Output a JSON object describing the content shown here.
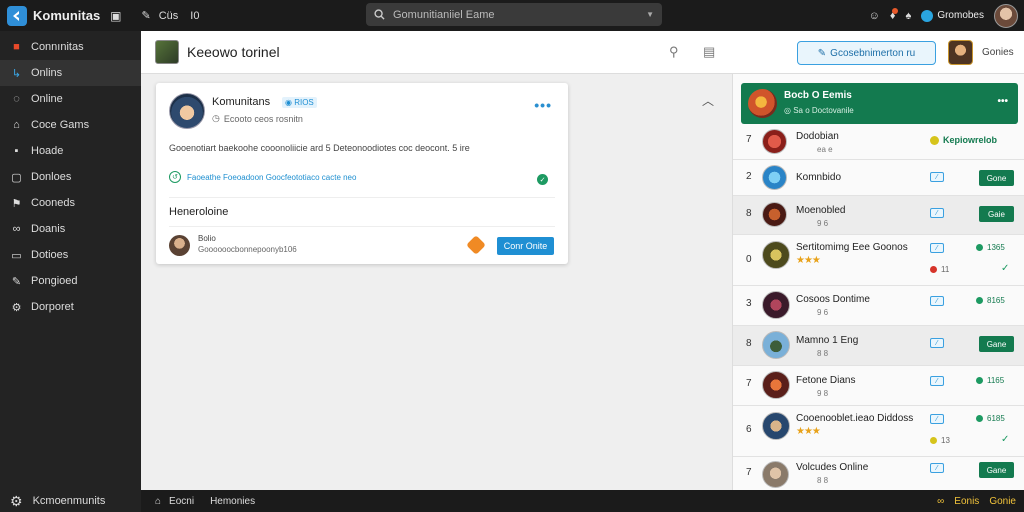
{
  "topbar": {
    "app_title": "Komunitas",
    "icon_a": "▣",
    "link_1": "Cüs",
    "link_2": "I0",
    "search_placeholder": "Gomunitianiiel Eame",
    "user_name": "Gromobes"
  },
  "sidebar": {
    "items": [
      {
        "label": "Connınitas",
        "icon": "square-icon"
      },
      {
        "label": "Onlins",
        "icon": "link-icon"
      },
      {
        "label": "Online",
        "icon": "circle-icon"
      },
      {
        "label": "Coce Gams",
        "icon": "home-icon"
      },
      {
        "label": "Hoade",
        "icon": "box-icon"
      },
      {
        "label": "Donloes",
        "icon": "square-icon"
      },
      {
        "label": "Cooneds",
        "icon": "flag-icon"
      },
      {
        "label": "Doanis",
        "icon": "link-icon"
      },
      {
        "label": "Dotioes",
        "icon": "box-icon"
      },
      {
        "label": "Pongioed",
        "icon": "tag-icon"
      },
      {
        "label": "Dorporet",
        "icon": "gear-icon"
      }
    ],
    "footer_label": "Kcmoenmunits"
  },
  "main_header": {
    "title": "Keeowo torinel",
    "cta_label": "Gcosebnimerton ru",
    "user_label": "Gonies"
  },
  "post": {
    "author": "Komunitans",
    "badge": "RIOS",
    "meta": "Ecooto ceos rosnitn",
    "text": "Gooenotiart baekoohe cooonoliicie ard 5 Deteonoodiotes coc deocont. 5 ire",
    "link": "Faoeathe Foeoadoon Goocfeototiaco cacte neo",
    "section": "Heneroloine",
    "comment_user": "Bolio",
    "comment_text": "Goooooocbonnepoonyb106",
    "reply_label": "Conr Onite"
  },
  "rpanel": {
    "header_title": "Bocb O Eemis",
    "header_sub": "Sa o Doctovanile",
    "rows": [
      {
        "rank": "7",
        "name": "Dodobian",
        "sub": "ea e",
        "label": "Kepiowrelob",
        "style": "label"
      },
      {
        "rank": "2",
        "name": "Komnbido",
        "tag": "⁄",
        "follow": "Gone",
        "style": "follow"
      },
      {
        "rank": "8",
        "name": "Moenobled",
        "sub": "9 6",
        "tag": "⁄",
        "follow": "Gaie",
        "style": "follow"
      },
      {
        "rank": "0",
        "name": "Sertitomimg Eee Goonos",
        "stars": "★★★",
        "tag": "⁄",
        "stat": "1365",
        "dot_val": "11",
        "style": "stat"
      },
      {
        "rank": "3",
        "name": "Cosoos Dontime",
        "sub": "9 6",
        "tag": "⁄",
        "stat": "8165",
        "style": "statonly"
      },
      {
        "rank": "8",
        "name": "Mamno 1 Eng",
        "sub": "8 8",
        "tag": "⁄",
        "follow": "Gane",
        "style": "follow"
      },
      {
        "rank": "7",
        "name": "Fetone Dians",
        "sub": "9 8",
        "tag": "⁄",
        "stat": "1165",
        "style": "statonly"
      },
      {
        "rank": "6",
        "name": "Cooenooblet.ieao Diddoss",
        "stars": "★★★",
        "tag": "⁄",
        "stat": "6185",
        "dot_val": "13",
        "style": "stat"
      },
      {
        "rank": "7",
        "name": "Volcudes Online",
        "sub": "8 8",
        "tag": "⁄",
        "follow": "Gane",
        "style": "follow"
      }
    ]
  },
  "bottombar": {
    "label_1": "Eocni",
    "label_2": "Hemonies",
    "right_1": "Eonis",
    "right_2": "Gonie"
  },
  "colors": {
    "accent": "#1f8fd3",
    "green": "#137a4f",
    "sidebar_bg": "#232323",
    "topbar_bg": "#1b1b1b"
  }
}
